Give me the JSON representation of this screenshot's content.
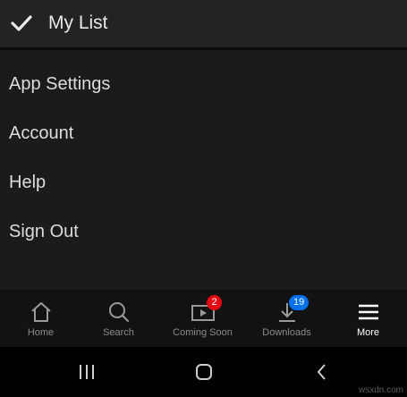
{
  "header": {
    "my_list_label": "My List",
    "icon": "check-icon"
  },
  "menu": {
    "items": [
      {
        "label": "App Settings"
      },
      {
        "label": "Account"
      },
      {
        "label": "Help"
      },
      {
        "label": "Sign Out"
      }
    ]
  },
  "bottom_nav": {
    "items": [
      {
        "label": "Home",
        "icon": "home-icon",
        "active": false
      },
      {
        "label": "Search",
        "icon": "search-icon",
        "active": false
      },
      {
        "label": "Coming Soon",
        "icon": "coming-soon-icon",
        "active": false,
        "badge": "2",
        "badge_color": "#e50914"
      },
      {
        "label": "Downloads",
        "icon": "download-icon",
        "active": false,
        "badge": "19",
        "badge_color": "#0071eb"
      },
      {
        "label": "More",
        "icon": "menu-icon",
        "active": true
      }
    ]
  },
  "system_nav": {
    "buttons": [
      "recents",
      "home",
      "back"
    ]
  },
  "watermark": "wsxdn.com",
  "colors": {
    "background": "#1b1b1b",
    "header": "#232323",
    "nav_bar": "#121212",
    "active_label": "#ffffff",
    "inactive_label": "#8c8c8c"
  }
}
